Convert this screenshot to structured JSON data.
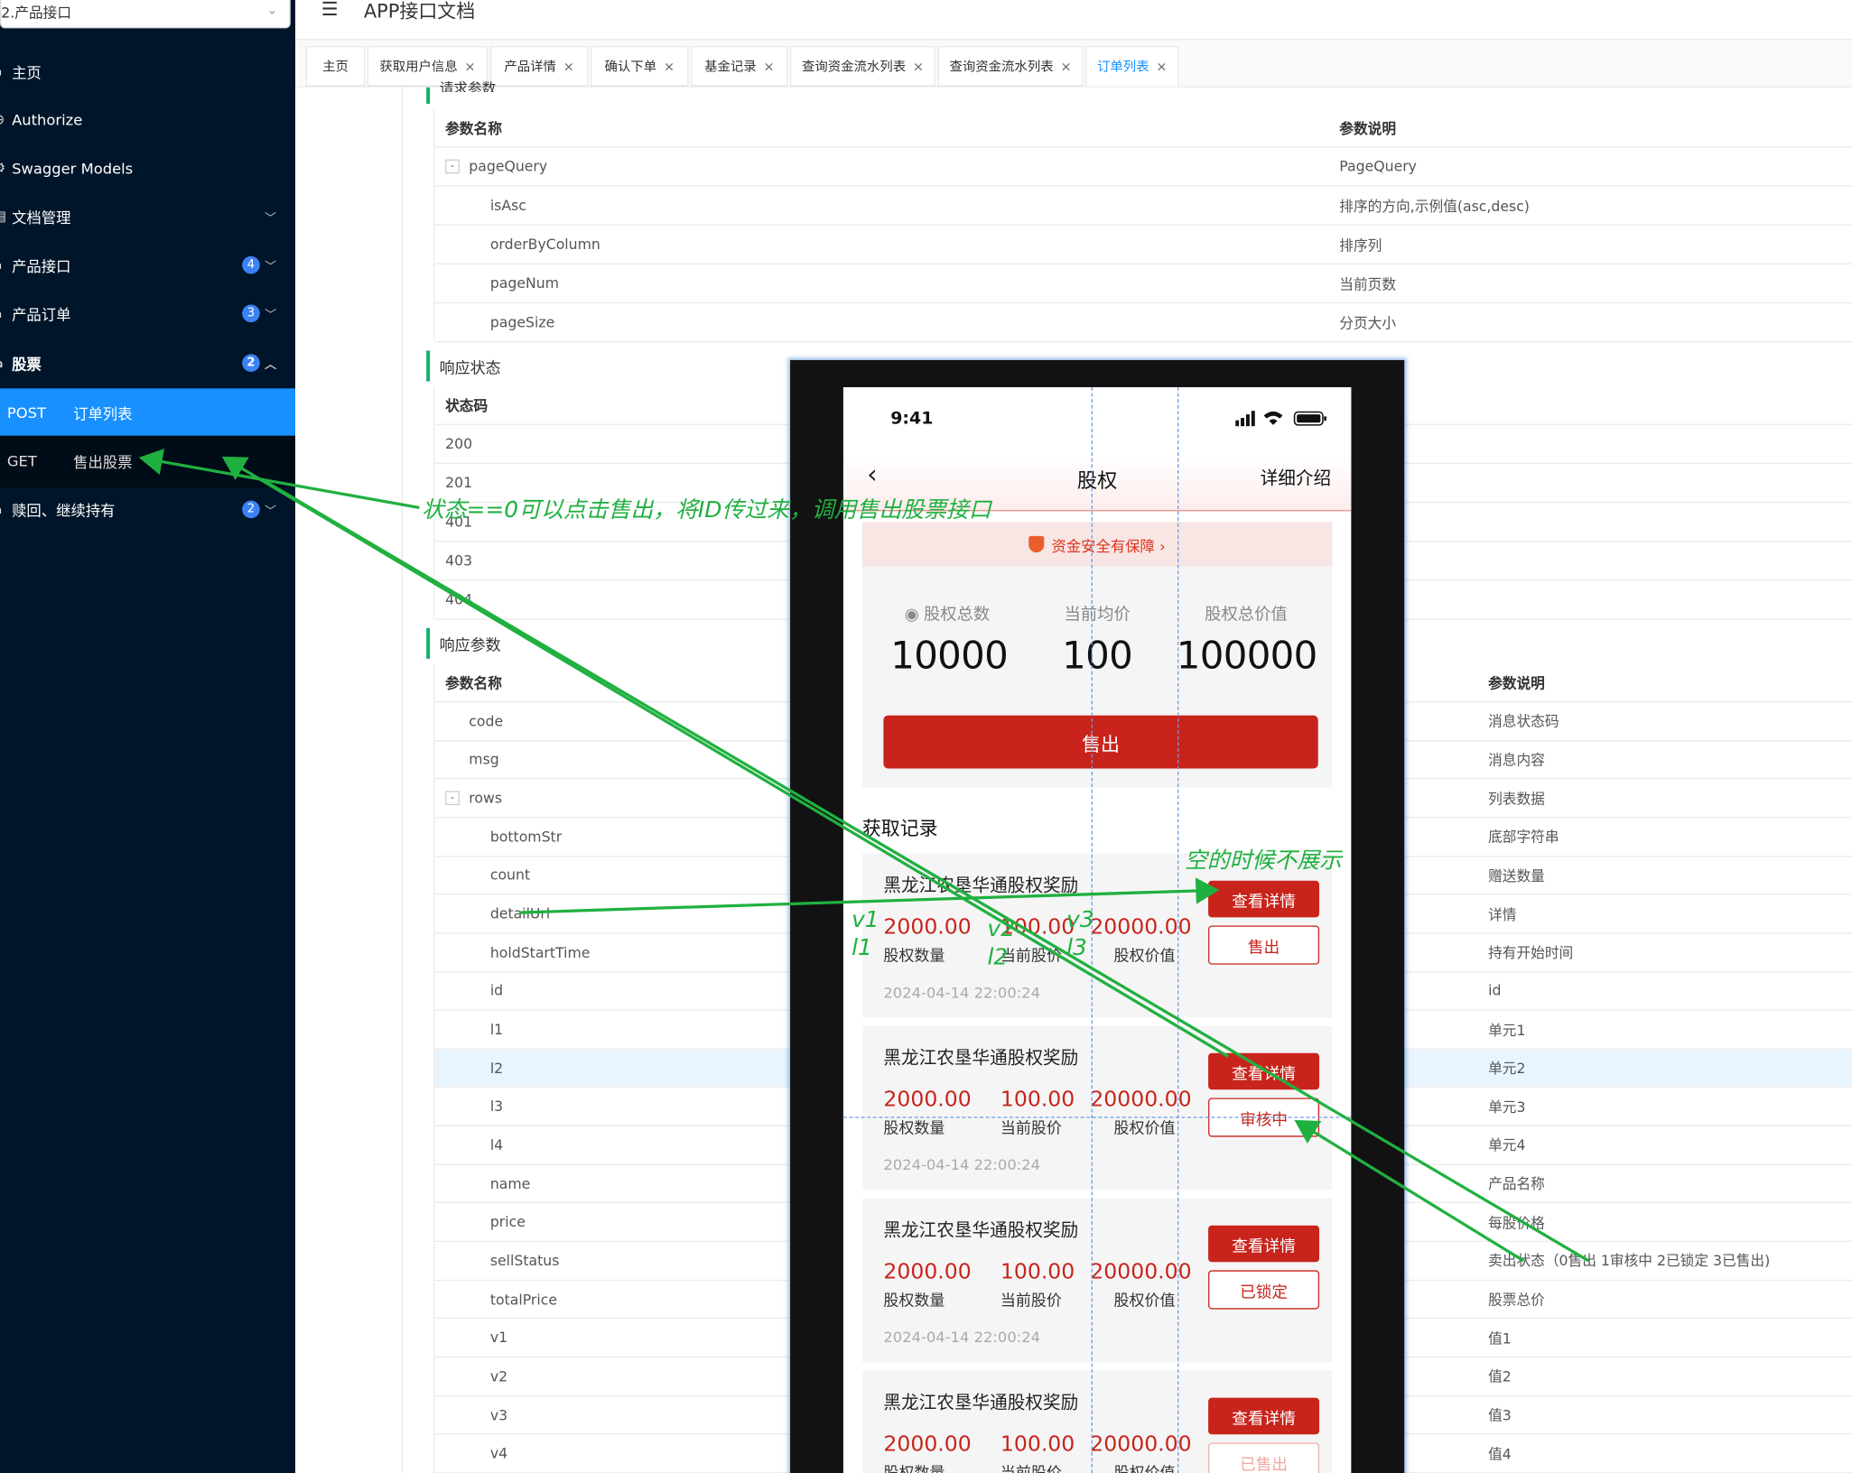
{
  "sidebar": {
    "select_value": "2.产品接口",
    "items": [
      {
        "label": "主页",
        "icon": "home-icon"
      },
      {
        "label": "Authorize",
        "icon": "lock-icon"
      },
      {
        "label": "Swagger Models",
        "icon": "gear-icon"
      },
      {
        "label": "文档管理",
        "icon": "folder-icon"
      },
      {
        "label": "产品接口",
        "icon": "api-icon",
        "badge": "4"
      },
      {
        "label": "产品订单",
        "icon": "api-icon",
        "badge": "3"
      },
      {
        "label": "股票",
        "icon": "api-icon",
        "badge": "2"
      },
      {
        "label": "赎回、继续持有",
        "icon": "api-icon",
        "badge": "2"
      }
    ],
    "sub_items": [
      {
        "method": "POST",
        "label": "订单列表"
      },
      {
        "method": "GET",
        "label": "售出股票"
      }
    ]
  },
  "header": {
    "title": "APP接口文档"
  },
  "tabs": [
    "主页",
    "获取用户信息",
    "产品详情",
    "确认下单",
    "基金记录",
    "查询资金流水列表",
    "查询资金流水列表",
    "订单列表"
  ],
  "request_params": {
    "section_title_partial": "请求参数",
    "columns": [
      "参数名称",
      "参数说明"
    ],
    "rows": [
      {
        "name": "pageQuery",
        "desc": "PageQuery",
        "toggle": "-"
      },
      {
        "name": "isAsc",
        "desc": "排序的方向,示例值(asc,desc)"
      },
      {
        "name": "orderByColumn",
        "desc": "排序列"
      },
      {
        "name": "pageNum",
        "desc": "当前页数"
      },
      {
        "name": "pageSize",
        "desc": "分页大小"
      }
    ]
  },
  "response_status": {
    "title": "响应状态",
    "column": "状态码",
    "codes": [
      "200",
      "201",
      "401",
      "403",
      "404"
    ]
  },
  "response_params": {
    "title": "响应参数",
    "columns": [
      "参数名称",
      "参数说明"
    ],
    "rows": [
      {
        "name": "code",
        "desc": "消息状态码"
      },
      {
        "name": "msg",
        "desc": "消息内容"
      },
      {
        "name": "rows",
        "desc": "列表数据",
        "toggle": "-"
      },
      {
        "name": "bottomStr",
        "desc": "底部字符串"
      },
      {
        "name": "count",
        "desc": "赠送数量"
      },
      {
        "name": "detailUrl",
        "desc": "详情"
      },
      {
        "name": "holdStartTime",
        "desc": "持有开始时间"
      },
      {
        "name": "id",
        "desc": "id"
      },
      {
        "name": "l1",
        "desc": "单元1"
      },
      {
        "name": "l2",
        "desc": "单元2"
      },
      {
        "name": "l3",
        "desc": "单元3"
      },
      {
        "name": "l4",
        "desc": "单元4"
      },
      {
        "name": "name",
        "desc": "产品名称"
      },
      {
        "name": "price",
        "desc": "每股价格"
      },
      {
        "name": "sellStatus",
        "desc": "卖出状态（0售出 1审核中 2已锁定 3已售出)"
      },
      {
        "name": "totalPrice",
        "desc": "股票总价"
      },
      {
        "name": "v1",
        "desc": "值1"
      },
      {
        "name": "v2",
        "desc": "值2"
      },
      {
        "name": "v3",
        "desc": "值3"
      },
      {
        "name": "v4",
        "desc": "值4"
      }
    ]
  },
  "phone": {
    "time": "9:41",
    "nav_title": "股权",
    "nav_right": "详细介绍",
    "safety_text": "资金安全有保障 ›",
    "summary": [
      {
        "label": "股权总数",
        "value": "10000"
      },
      {
        "label": "当前均价",
        "value": "100"
      },
      {
        "label": "股权总价值",
        "value": "100000"
      }
    ],
    "sell_button": "售出",
    "records_title": "获取记录",
    "records": [
      {
        "name": "黑龙江农垦华通股权奖励",
        "v1": "2000.00",
        "v2": "100.00",
        "v3": "20000.00",
        "l1": "股权数量",
        "l2": "当前股价",
        "l3": "股权价值",
        "date": "2024-04-14 22:00:24",
        "detail_btn": "查看详情",
        "status_btn": "售出",
        "status_style": "normal"
      },
      {
        "name": "黑龙江农垦华通股权奖励",
        "v1": "2000.00",
        "v2": "100.00",
        "v3": "20000.00",
        "l1": "股权数量",
        "l2": "当前股价",
        "l3": "股权价值",
        "date": "2024-04-14 22:00:24",
        "detail_btn": "查看详情",
        "status_btn": "审核中",
        "status_style": "normal"
      },
      {
        "name": "黑龙江农垦华通股权奖励",
        "v1": "2000.00",
        "v2": "100.00",
        "v3": "20000.00",
        "l1": "股权数量",
        "l2": "当前股价",
        "l3": "股权价值",
        "date": "2024-04-14 22:00:24",
        "detail_btn": "查看详情",
        "status_btn": "已锁定",
        "status_style": "normal"
      },
      {
        "name": "黑龙江农垦华通股权奖励",
        "v1": "2000.00",
        "v2": "100.00",
        "v3": "20000.00",
        "l1": "股权数量",
        "l2": "当前股价",
        "l3": "股权价值",
        "date": "",
        "detail_btn": "查看详情",
        "status_btn": "已售出",
        "status_style": "faded"
      }
    ]
  },
  "annotations": {
    "main_note": "状态==0可以点击售出，将ID传过来，调用售出股票接口",
    "empty_note": "空的时候不展示",
    "v1": "v1",
    "l1": "l1",
    "v2": "v2",
    "l2": "l2",
    "v3": "v3",
    "l3": "l3",
    "color": "#20b040"
  },
  "colors": {
    "sidebar_bg": "#001529",
    "active_blue": "#1890ff",
    "accent_red": "#c8241c",
    "section_green": "#13ae6e"
  }
}
